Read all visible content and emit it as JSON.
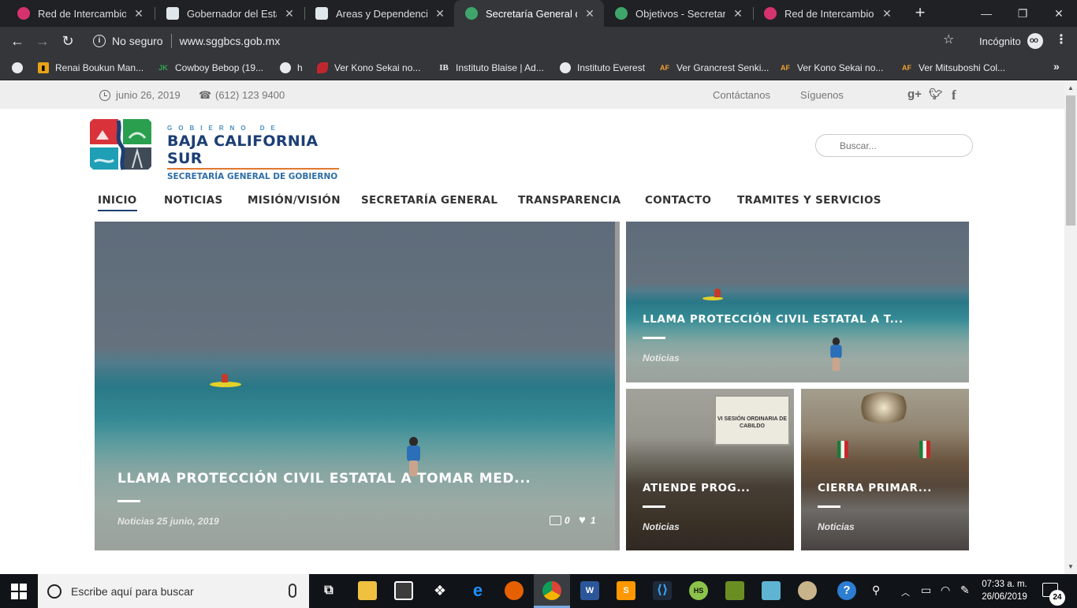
{
  "browser": {
    "tabs": [
      {
        "title": "Red de Intercambio de",
        "favicon_color": "#d6336c",
        "active": false
      },
      {
        "title": "Gobernador del Estado",
        "favicon_color": "#dfe6ec",
        "active": false
      },
      {
        "title": "Areas y Dependencias |",
        "favicon_color": "#dfe6ec",
        "active": false
      },
      {
        "title": "Secretaría General de G",
        "favicon_color": "#3fa66b",
        "active": true
      },
      {
        "title": "Objetivos - Secretaría d",
        "favicon_color": "#3fa66b",
        "active": false
      },
      {
        "title": "Red de Intercambio de",
        "favicon_color": "#d6336c",
        "active": false
      }
    ],
    "security_label": "No seguro",
    "url": "www.sggbcs.gob.mx",
    "incognito_label": "Incógnito",
    "bookmarks": [
      {
        "label": "Renai Boukun Man...",
        "icon": "bookmark-manga-icon",
        "color": "#e8a317"
      },
      {
        "label": "Cowboy Bebop (19...",
        "icon": "bookmark-jk-icon",
        "color": "#2fa84f"
      },
      {
        "label": "h",
        "icon": "globe-icon",
        "color": "#e8eaed"
      },
      {
        "label": "Ver Kono Sekai no...",
        "icon": "bookmark-red-icon",
        "color": "#c0262d"
      },
      {
        "label": "Instituto Blaise | Ad...",
        "icon": "bookmark-ib-icon",
        "color": "#e8eaed"
      },
      {
        "label": "Instituto Everest",
        "icon": "globe-icon",
        "color": "#e8eaed"
      },
      {
        "label": "Ver Grancrest Senki...",
        "icon": "bookmark-af-icon",
        "color": "#f0a030"
      },
      {
        "label": "Ver Kono Sekai no...",
        "icon": "bookmark-af-icon",
        "color": "#f0a030"
      },
      {
        "label": "Ver Mitsuboshi Col...",
        "icon": "bookmark-af-icon",
        "color": "#f0a030"
      }
    ]
  },
  "site": {
    "topbar": {
      "date": "junio 26, 2019",
      "phone": "(612) 123 9400",
      "contact": "Contáctanos",
      "follow": "Síguenos",
      "social": [
        "g+",
        "twitter",
        "facebook"
      ]
    },
    "logo": {
      "line1": "GOBIERNO DE",
      "line2": "BAJA CALIFORNIA SUR",
      "line3": "SECRETARÍA GENERAL DE GOBIERNO"
    },
    "search": {
      "placeholder": "Buscar..."
    },
    "nav": [
      {
        "label": "INICIO",
        "active": true
      },
      {
        "label": "NOTICIAS",
        "active": false
      },
      {
        "label": "MISIÓN/VISIÓN",
        "active": false
      },
      {
        "label": "SECRETARÍA GENERAL",
        "active": false
      },
      {
        "label": "TRANSPARENCIA",
        "active": false
      },
      {
        "label": "CONTACTO",
        "active": false
      },
      {
        "label": "TRAMITES Y SERVICIOS",
        "active": false
      }
    ],
    "featured": {
      "title": "LLAMA PROTECCIÓN CIVIL ESTATAL A TOMAR MED...",
      "meta": "Noticias 25 junio, 2019",
      "comments": "0",
      "likes": "1"
    },
    "side_top": {
      "title": "LLAMA PROTECCIÓN CIVIL ESTATAL A T...",
      "meta": "Noticias"
    },
    "side_left": {
      "title": "ATIENDE PROG...",
      "meta": "Noticias",
      "board_text": "VI SESIÓN ORDINARIA DE CABILDO"
    },
    "side_right": {
      "title": "CIERRA PRIMAR...",
      "meta": "Noticias"
    }
  },
  "taskbar": {
    "search_placeholder": "Escribe aquí para buscar",
    "time": "07:33 a. m.",
    "date": "26/06/2019",
    "notifications": "24"
  }
}
